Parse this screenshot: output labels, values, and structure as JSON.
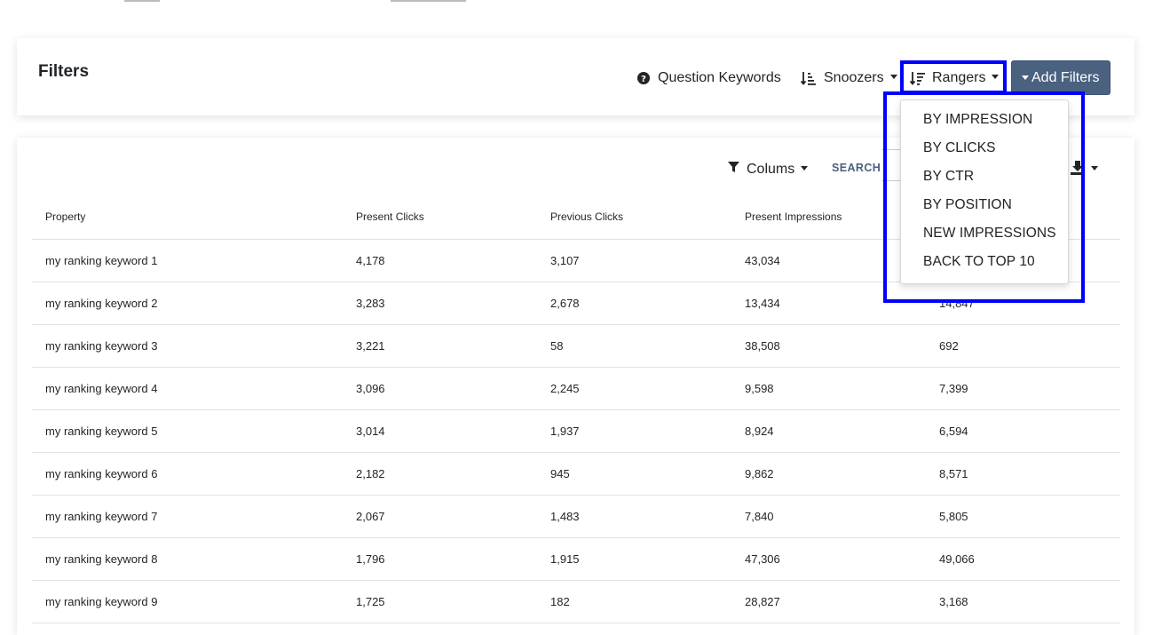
{
  "filters": {
    "title": "Filters",
    "question_keywords": "Question Keywords",
    "snoozers": "Snoozers",
    "rangers": "Rangers",
    "add_filters": "Add Filters"
  },
  "rangers_menu": {
    "items": [
      "BY IMPRESSION",
      "BY CLICKS",
      "BY CTR",
      "BY POSITION",
      "NEW IMPRESSIONS",
      "BACK TO TOP 10"
    ]
  },
  "toolbar": {
    "columns": "Colums",
    "search": "SEARCH"
  },
  "table": {
    "headers": [
      "Property",
      "Present Clicks",
      "Previous Clicks",
      "Present Impressions",
      ""
    ],
    "rows": [
      [
        "my ranking keyword 1",
        "4,178",
        "3,107",
        "43,034",
        ""
      ],
      [
        "my ranking keyword 2",
        "3,283",
        "2,678",
        "13,434",
        "14,847"
      ],
      [
        "my ranking keyword 3",
        "3,221",
        "58",
        "38,508",
        "692"
      ],
      [
        "my ranking keyword 4",
        "3,096",
        "2,245",
        "9,598",
        "7,399"
      ],
      [
        "my ranking keyword 5",
        "3,014",
        "1,937",
        "8,924",
        "6,594"
      ],
      [
        "my ranking keyword 6",
        "2,182",
        "945",
        "9,862",
        "8,571"
      ],
      [
        "my ranking keyword 7",
        "2,067",
        "1,483",
        "7,840",
        "5,805"
      ],
      [
        "my ranking keyword 8",
        "1,796",
        "1,915",
        "47,306",
        "49,066"
      ],
      [
        "my ranking keyword 9",
        "1,725",
        "182",
        "28,827",
        "3,168"
      ]
    ]
  },
  "colors": {
    "highlight": "#0000ff",
    "add_filters_bg": "#4a6180",
    "search_text": "#4a6180"
  }
}
